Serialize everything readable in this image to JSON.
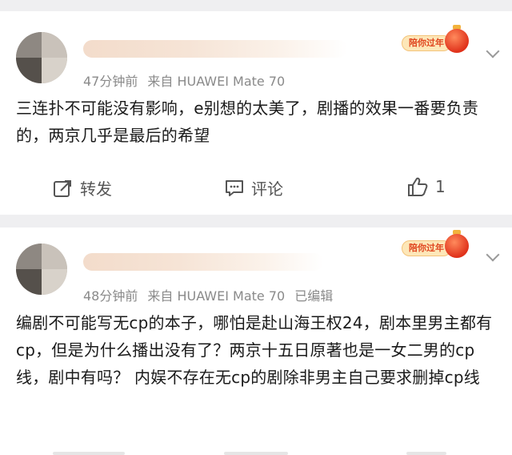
{
  "posts": [
    {
      "time": "47分钟前",
      "source": "来自 HUAWEI Mate 70",
      "edited": "",
      "badge": "陪你过年",
      "body": "三连扑不可能没有影响，e别想的太美了，剧播的效果一番要负责的，两京几乎是最后的希望",
      "actions": {
        "repost": "转发",
        "comment": "评论",
        "like_count": "1"
      }
    },
    {
      "time": "48分钟前",
      "source": "来自 HUAWEI Mate 70",
      "edited": "已编辑",
      "badge": "陪你过年",
      "body": "编剧不可能写无cp的本子，哪怕是赴山海王权24，剧本里男主都有cp，但是为什么播出没有了？两京十五日原著也是一女二男的cp线，剧中有吗？ 内娱不存在无cp的剧除非男主自己要求删掉cp线"
    }
  ],
  "icons": {
    "repost": "share-icon",
    "comment": "comment-icon",
    "like": "thumbs-up-icon",
    "more": "chevron-down-icon"
  },
  "colors": {
    "badge_text": "#e0461f",
    "meta": "#8a8a8a",
    "body": "#1a1a1a"
  }
}
